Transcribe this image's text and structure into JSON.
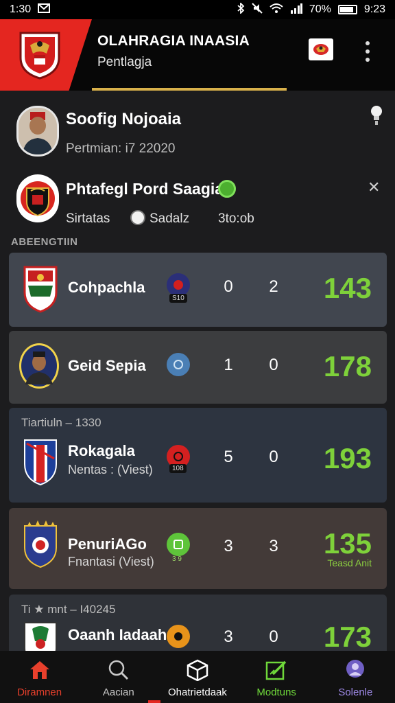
{
  "status_bar": {
    "time_left": "1:30",
    "battery": "70%",
    "time_right": "9:23"
  },
  "header": {
    "title": "OLAHRAGIA INAASIA",
    "subtitle": "Pentlagja"
  },
  "profile": {
    "name": "Soofig Nojoaia",
    "period": "Pertmian: i7 22020"
  },
  "team": {
    "name": "Phtafegl Pord Saagia",
    "stat1": "Sirtatas",
    "stat2": "Sadalz",
    "stat3": "3to:ob"
  },
  "section_title": "ABEENGTIIN",
  "matches": [
    {
      "name": "Cohpachla",
      "tag": "",
      "sub": "",
      "badge_label": "",
      "mini": "S10",
      "score_a": "0",
      "score_b": "2",
      "total": "143",
      "total_sub": ""
    },
    {
      "name": "Geid Sepia",
      "tag": "",
      "sub": "",
      "badge_label": "",
      "mini": "",
      "score_a": "1",
      "score_b": "0",
      "total": "178",
      "total_sub": ""
    },
    {
      "name": "Rokagala",
      "tag": "Tiartiuln – 1330",
      "sub": "Nentas : (Viest)",
      "badge_label": "",
      "mini": "108",
      "score_a": "5",
      "score_b": "0",
      "total": "193",
      "total_sub": ""
    },
    {
      "name": "PenuriAGo",
      "tag": "",
      "sub": "Fnantasi (Viest)",
      "badge_label": "",
      "mini": "3 9",
      "score_a": "3",
      "score_b": "3",
      "total": "135",
      "total_sub": "Teasd Anit"
    },
    {
      "name": "Oaanh Iadaahs",
      "tag": "Ti ★ mnt – I40245",
      "sub": "",
      "badge_label": "",
      "mini": "",
      "score_a": "3",
      "score_b": "0",
      "total": "173",
      "total_sub": ""
    }
  ],
  "nav": [
    {
      "label": "Diramnen",
      "color": "#e8402c",
      "icon": "home-icon"
    },
    {
      "label": "Aacian",
      "color": "#c9c9c9",
      "icon": "search-icon"
    },
    {
      "label": "Ohatrietdaak",
      "color": "#ffffff",
      "icon": "cube-icon"
    },
    {
      "label": "Modtuns",
      "color": "#6fd83a",
      "icon": "edit-icon"
    },
    {
      "label": "Solenle",
      "color": "#9f8ae8",
      "icon": "profile-icon"
    }
  ],
  "colors": {
    "accent_red": "#e42620",
    "score_green": "#7ed13a",
    "gold": "#d8b04a"
  }
}
